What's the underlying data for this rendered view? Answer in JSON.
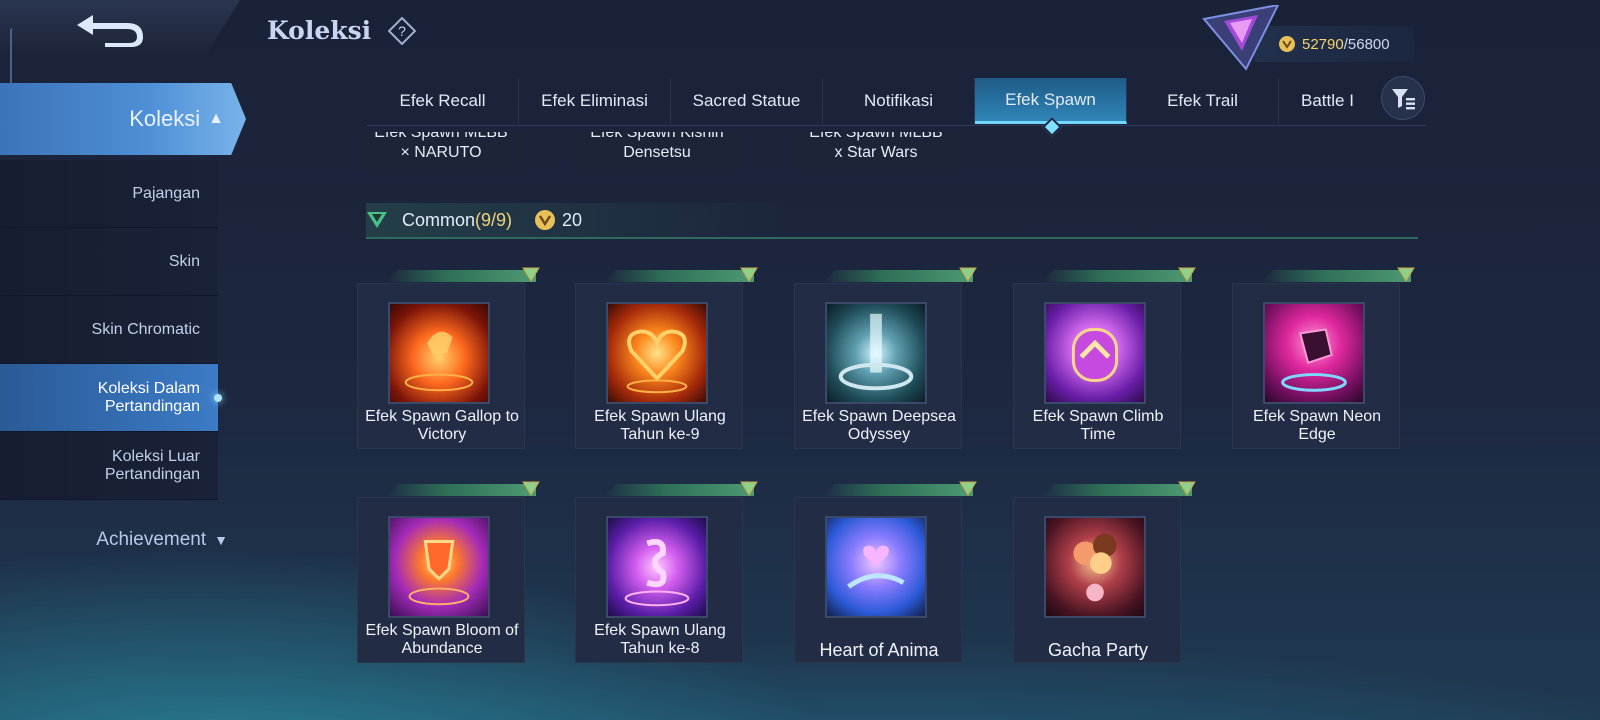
{
  "header": {
    "title": "Koleksi",
    "currency_current": "52790",
    "currency_max": "/56800"
  },
  "sidebar": {
    "main_label": "Koleksi",
    "items": [
      {
        "label": "Pajangan"
      },
      {
        "label": "Skin"
      },
      {
        "label": "Skin Chromatic"
      },
      {
        "label": "Koleksi Dalam Pertandingan"
      },
      {
        "label": "Koleksi Luar Pertandingan"
      }
    ],
    "achievement_label": "Achievement"
  },
  "tabs": [
    {
      "label": "Efek Recall"
    },
    {
      "label": "Efek Eliminasi"
    },
    {
      "label": "Sacred Statue"
    },
    {
      "label": "Notifikasi"
    },
    {
      "label": "Efek Spawn"
    },
    {
      "label": "Efek Trail"
    },
    {
      "label": "Battle I"
    }
  ],
  "active_tab": "Efek Spawn",
  "partial_cards": [
    {
      "line1": "Efek Spawn MLBB",
      "line2": "× NARUTO"
    },
    {
      "line1": "Efek Spawn Kishin",
      "line2": "Densetsu"
    },
    {
      "line1": "Efek Spawn MLBB",
      "line2": "x Star Wars"
    }
  ],
  "section": {
    "title": "Common",
    "count": "(9/9)",
    "value": "20"
  },
  "cards": [
    {
      "name": "Efek Spawn Gallop to Victory"
    },
    {
      "name": "Efek Spawn Ulang Tahun ke-9"
    },
    {
      "name": "Efek Spawn Deepsea Odyssey"
    },
    {
      "name": "Efek Spawn Climb Time"
    },
    {
      "name": "Efek Spawn Neon Edge"
    },
    {
      "name": "Efek Spawn Bloom of Abundance"
    },
    {
      "name": "Efek Spawn Ulang Tahun ke-8"
    },
    {
      "name": "Heart of Anima"
    },
    {
      "name": "Gacha Party"
    }
  ],
  "colors": {
    "accent": "#3c7bc6",
    "tab_active": "#2f86b8",
    "currency": "#f4d46c",
    "rarity_common": "#4e9a72"
  },
  "icons": [
    "back-arrow-icon",
    "help-icon",
    "rank-badge-icon",
    "coin-icon",
    "filter-icon",
    "chevron-up-icon",
    "chevron-down-icon",
    "rarity-icon"
  ]
}
